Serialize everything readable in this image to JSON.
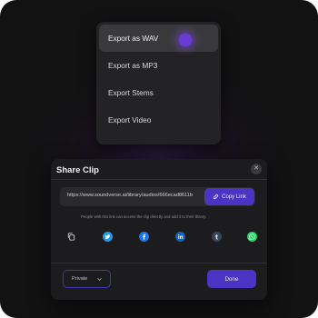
{
  "export_menu": {
    "items": [
      {
        "label": "Export as WAV",
        "active": true
      },
      {
        "label": "Export as MP3",
        "active": false
      },
      {
        "label": "Export Stems",
        "active": false
      },
      {
        "label": "Export Video",
        "active": false
      }
    ]
  },
  "share_dialog": {
    "title": "Share Clip",
    "close_icon": "close-icon",
    "link_value": "https://www.soundverse.ai/library/audios/666ecad8611b",
    "copy_label": "Copy Link",
    "hint": "People with this link can access the clip directly and add it to their library.",
    "socials": [
      {
        "name": "copy-icon"
      },
      {
        "name": "twitter-icon",
        "color": "#1d9bf0"
      },
      {
        "name": "facebook-icon",
        "color": "#1877f2"
      },
      {
        "name": "linkedin-icon",
        "color": "#0a66c2"
      },
      {
        "name": "tumblr-icon",
        "color": "#35465c"
      },
      {
        "name": "whatsapp-icon",
        "color": "#25d366"
      }
    ],
    "privacy_value": "Private",
    "done_label": "Done"
  },
  "colors": {
    "accent": "#4b33c4",
    "background": "#131214",
    "panel": "#1c1c1e"
  }
}
